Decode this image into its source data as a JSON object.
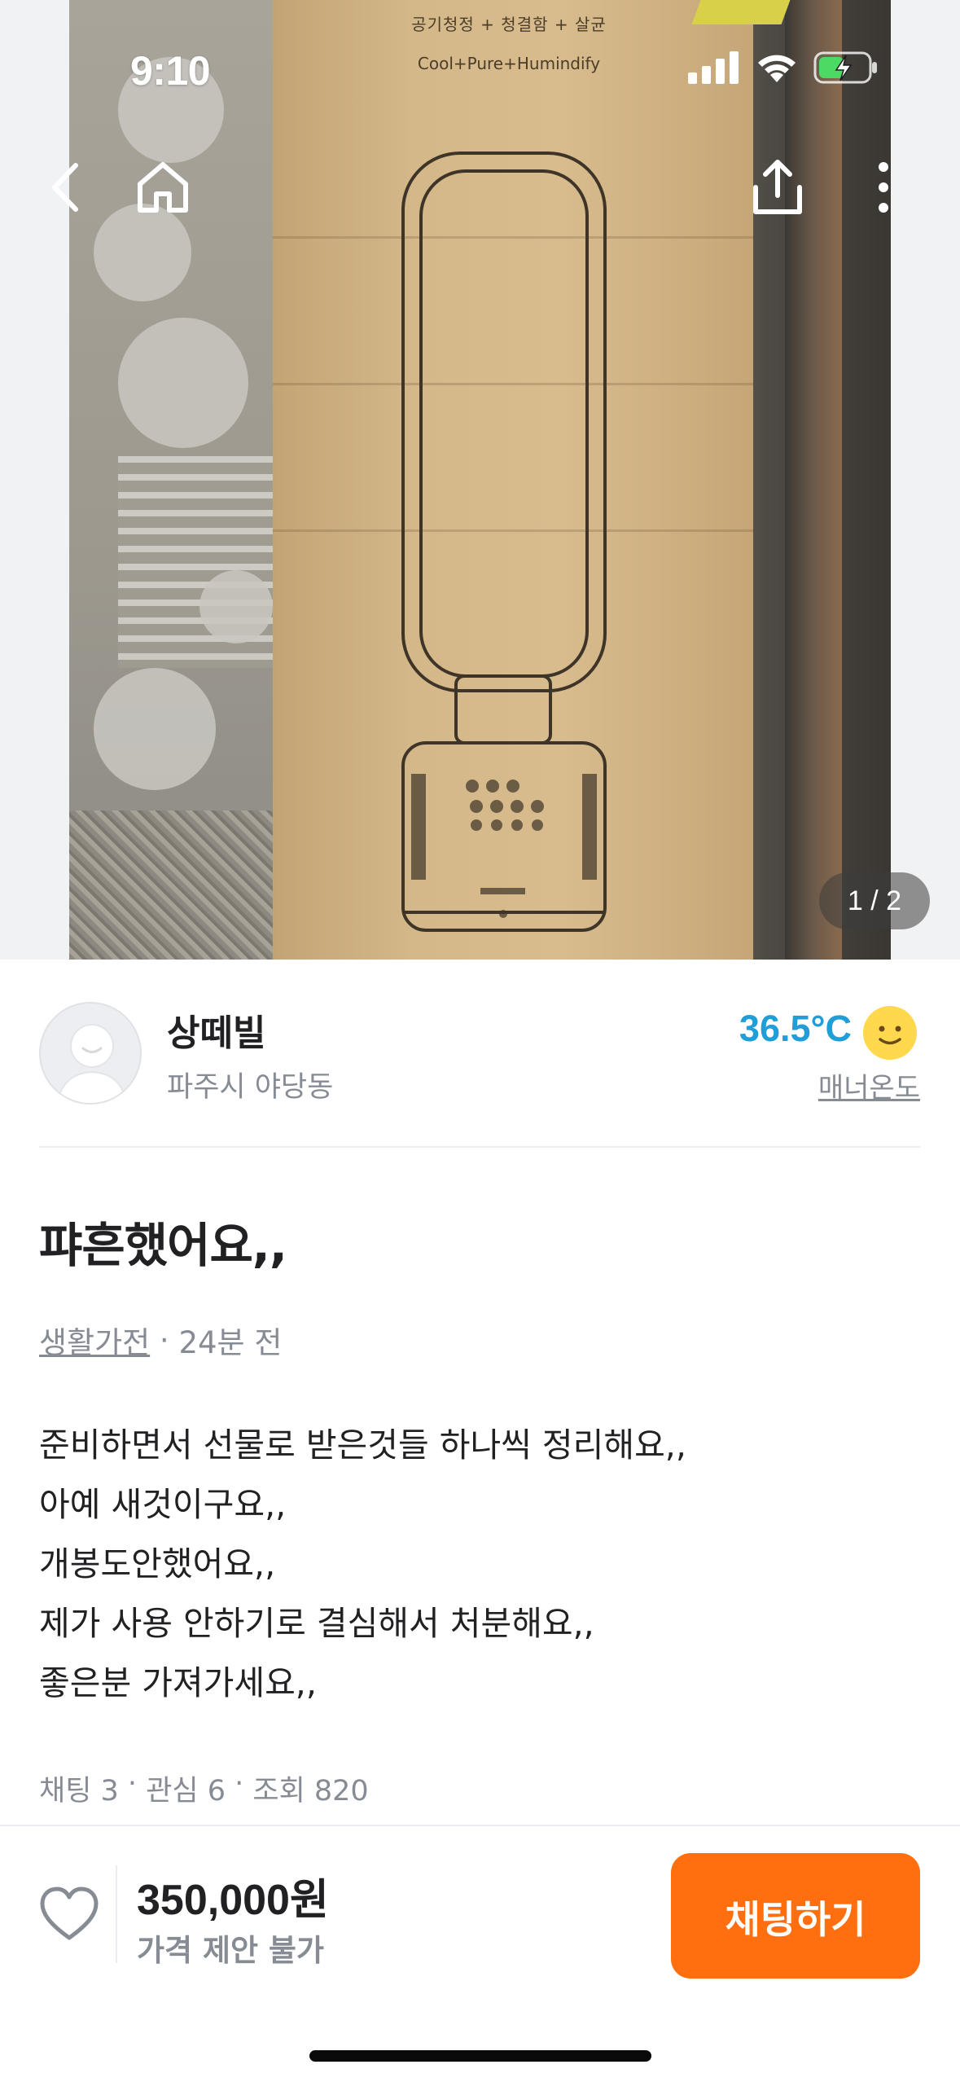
{
  "status_bar": {
    "time": "9:10",
    "icons": [
      "cellular-signal-icon",
      "wifi-icon",
      "battery-charging-icon"
    ]
  },
  "top_nav": {
    "back_icon": "chevron-left-icon",
    "home_icon": "home-icon",
    "share_icon": "share-icon",
    "more_icon": "more-vertical-icon"
  },
  "photo": {
    "box_print_line1": "공기청정 + 청결함 + 살균",
    "box_print_line2": "Cool+Pure+Humindify",
    "counter": "1 / 2"
  },
  "seller": {
    "name": "상떼빌",
    "location": "파주시 야당동",
    "temperature": "36.5°C",
    "temperature_label": "매너온도",
    "temperature_color": "#1f9ed8"
  },
  "post": {
    "title": "퍄흔했어요,,",
    "category": "생활가전",
    "separator": " · ",
    "time_ago": "24분 전",
    "body": [
      "준비하면서 선물로 받은것들 하나씩 정리해요,,",
      "아예 새것이구요,,",
      "개봉도안했어요,,",
      "제가 사용 안하기로 결심해서 처분해요,,",
      "좋은분 가져가세요,,"
    ],
    "stats": {
      "chat": "채팅 3",
      "likes": "관심 6",
      "views": "조회 820",
      "separator": " · "
    }
  },
  "bottom_bar": {
    "price": "350,000원",
    "price_note": "가격 제안 불가",
    "chat_button": "채팅하기",
    "accent_color": "#ff6f0f"
  }
}
